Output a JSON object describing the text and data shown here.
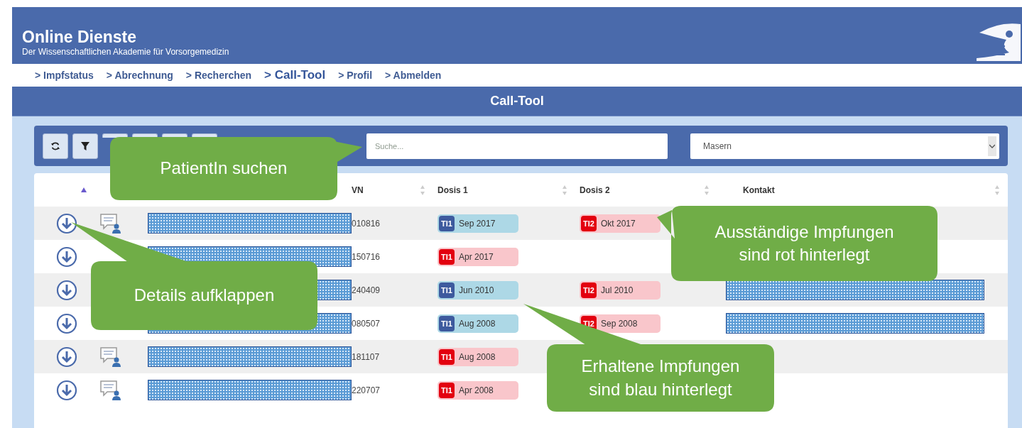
{
  "header": {
    "title": "Online Dienste",
    "subtitle": "Der Wissenschaftlichen Akademie für Vorsorgemedizin"
  },
  "nav": [
    {
      "label": "> Impfstatus",
      "selected": false
    },
    {
      "label": "> Abrechnung",
      "selected": false
    },
    {
      "label": "> Recherchen",
      "selected": false
    },
    {
      "label": "> Call-Tool",
      "selected": true
    },
    {
      "label": "> Profil",
      "selected": false
    },
    {
      "label": "> Abmelden",
      "selected": false
    }
  ],
  "page_title": "Call-Tool",
  "toolbar": {
    "search": {
      "placeholder": "Suche..."
    },
    "vaccine_select": {
      "value": "Masern"
    }
  },
  "table": {
    "columns": [
      {
        "label": "VN"
      },
      {
        "label": "Dosis 1"
      },
      {
        "label": "Dosis 2"
      },
      {
        "label": "Kontakt"
      }
    ],
    "rows": [
      {
        "chat_icon": true,
        "name": {
          "kind": "redacted"
        },
        "svnr": "010816",
        "doses": [
          {
            "tag": "TI1",
            "date": "Sep 2017",
            "color": "#3d5a9e"
          },
          {
            "tag": "TI2",
            "date": "Okt 2017",
            "color": "#e3000f"
          }
        ]
      },
      {
        "chat_icon": false,
        "name": {
          "kind": "redacted"
        },
        "svnr": "150716",
        "doses": [
          {
            "tag": "TI1",
            "date": "Apr 2017",
            "color": "#e3000f"
          }
        ]
      },
      {
        "chat_icon": false,
        "name": {
          "kind": "redacted"
        },
        "svnr": "240409",
        "doses": [
          {
            "tag": "TI1",
            "date": "Jun 2010",
            "color": "#3d5a9e"
          },
          {
            "tag": "TI2",
            "date": "Jul 2010",
            "color": "#e3000f"
          }
        ],
        "contact": {
          "kind": "redacted"
        }
      },
      {
        "chat_icon": false,
        "name": {
          "kind": "redacted"
        },
        "svnr": "080507",
        "doses": [
          {
            "tag": "TI1",
            "date": "Aug 2008",
            "color": "#3d5a9e"
          },
          {
            "tag": "TI2",
            "date": "Sep 2008",
            "color": "#e3000f"
          }
        ],
        "contact": {
          "kind": "redacted"
        }
      },
      {
        "chat_icon": true,
        "name": {
          "kind": "redacted"
        },
        "svnr": "181107",
        "doses": [
          {
            "tag": "TI1",
            "date": "Aug 2008",
            "color": "#e3000f"
          }
        ]
      },
      {
        "chat_icon": true,
        "name": {
          "kind": "redacted"
        },
        "svnr": "220707",
        "doses": [
          {
            "tag": "TI1",
            "date": "Apr 2008",
            "color": "#e3000f"
          }
        ]
      }
    ]
  },
  "callouts": [
    {
      "text": "PatientIn suchen"
    },
    {
      "text": "Details aufklappen"
    },
    {
      "text": "Ausständige Impfungen sind rot hinterlegt"
    },
    {
      "text": "Erhaltene Impfungen sind blau hinterlegt"
    }
  ]
}
